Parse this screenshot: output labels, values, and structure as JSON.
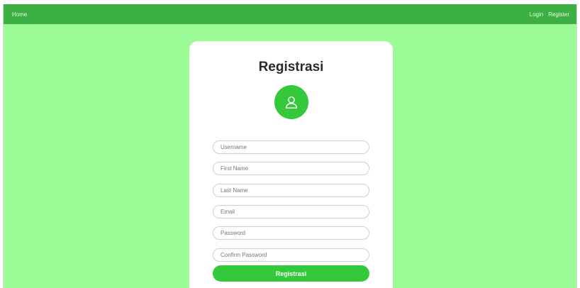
{
  "navbar": {
    "home": "Home",
    "login": "Login",
    "register": "Register"
  },
  "form": {
    "title": "Registrasi",
    "icon": "user-icon",
    "fields": {
      "username": "Username",
      "first_name": "First Name",
      "last_name": "Last Name",
      "email": "Email",
      "password": "Password",
      "confirm_password": "Confirm Password"
    },
    "submit_label": "Registrasi"
  },
  "colors": {
    "background": "#9bfb97",
    "navbar": "#3cb043",
    "accent": "#34c93a"
  }
}
